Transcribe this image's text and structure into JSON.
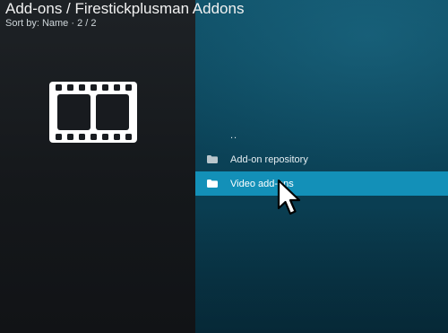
{
  "header": {
    "title": "Add-ons / Firestickplusman Addons",
    "subtitle": "Sort by: Name  ·  2 / 2"
  },
  "list": {
    "items": [
      {
        "label": "..",
        "icon": "",
        "selected": false
      },
      {
        "label": "Add-on repository",
        "icon": "folder-icon",
        "selected": false
      },
      {
        "label": "Video add-ons",
        "icon": "folder-icon",
        "selected": true
      }
    ]
  },
  "preview": {
    "icon": "film-strip-icon"
  },
  "colors": {
    "selection": "#1390b8",
    "right_panel": "#0b4257",
    "left_panel": "#181b1f"
  }
}
